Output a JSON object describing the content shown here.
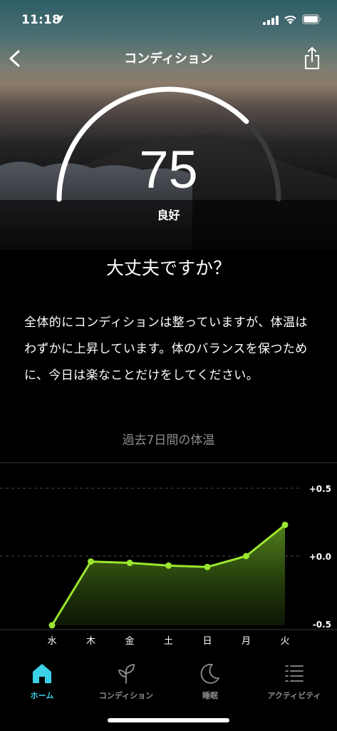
{
  "status_bar": {
    "time": "11:18"
  },
  "header": {
    "title": "コンディション"
  },
  "condition": {
    "score": "75",
    "score_value": 75,
    "score_max": 100,
    "label": "良好",
    "headline": "大丈夫ですか？",
    "message": "全体的にコンディションは整っていますが、体温はわずかに上昇しています。体のバランスを保つために、今日は楽なことだけをしてください。"
  },
  "colors": {
    "accent": "#3ad1e6",
    "chart_line": "#9be62e",
    "inactive": "#8e8e93"
  },
  "chart_data": {
    "type": "area",
    "title": "過去7日間の体温",
    "categories": [
      "水",
      "木",
      "金",
      "土",
      "日",
      "月",
      "火"
    ],
    "values": [
      -0.51,
      -0.04,
      -0.05,
      -0.07,
      -0.08,
      0.0,
      0.23
    ],
    "y_ticks": [
      "+0.5",
      "+0.0",
      "-0.5"
    ],
    "ylim": [
      -0.5,
      0.5
    ],
    "grid": true
  },
  "tabs": [
    {
      "label": "ホーム",
      "icon": "home-icon",
      "active": true
    },
    {
      "label": "コンディション",
      "icon": "sprout-icon",
      "active": false
    },
    {
      "label": "睡眠",
      "icon": "moon-icon",
      "active": false
    },
    {
      "label": "アクティビティ",
      "icon": "activity-list-icon",
      "active": false
    }
  ]
}
